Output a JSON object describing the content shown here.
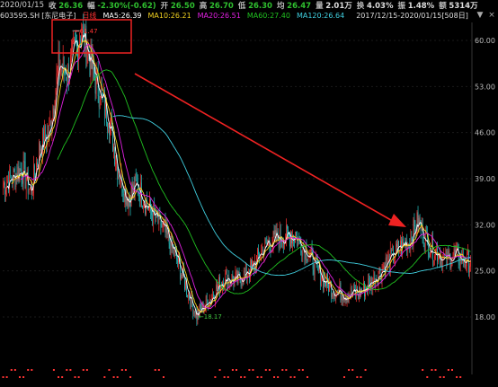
{
  "quote": {
    "date": "2020/01/15",
    "close_label": "收",
    "close": "26.36",
    "change_label": "幅",
    "change": "-2.30%(-0.62)",
    "open_label": "开",
    "open": "26.50",
    "high_label": "高",
    "high": "26.70",
    "low_label": "低",
    "low": "26.30",
    "avg_label": "均",
    "avg": "26.47",
    "volume_label": "量",
    "volume": "2.01万",
    "turnover_label": "换",
    "turnover": "4.03%",
    "amplitude_label": "振",
    "amplitude": "1.48%",
    "amount_label": "额",
    "amount": "5314万"
  },
  "indicators": {
    "symbol": "603595.SH",
    "name": "[东尼电子]",
    "mode": "日线",
    "ma5": "MA5:26.39",
    "ma10": "MA10:26.21",
    "ma20": "MA20:26.51",
    "ma60": "MA60:27.40",
    "ma120": "MA120:26.64",
    "range": "2017/12/15-2020/01/15[508日]"
  },
  "controls": {
    "dropdown": "▼",
    "close": "×"
  },
  "colors": {
    "up": "#ff3333",
    "down": "#28c8c8",
    "ma5": "#ffffff",
    "ma10": "#f0d020",
    "ma20": "#e020e0",
    "ma60": "#20c020",
    "ma120": "#40d0e0",
    "annotation": "#ee2222"
  },
  "annotations": {
    "peak_label": "61.47",
    "trough_label": "18.17"
  },
  "chart_data": {
    "type": "candlestick",
    "y_ticks": [
      "60.00",
      "53.00",
      "46.00",
      "39.00",
      "32.00",
      "25.00",
      "18.00"
    ],
    "ylim": [
      15.5,
      63
    ],
    "x_range": [
      "2017/12/15",
      "2020/01/15"
    ],
    "bars": 508,
    "price_path": [
      [
        0,
        38.0
      ],
      [
        20,
        40.5
      ],
      [
        30,
        37.0
      ],
      [
        40,
        44.0
      ],
      [
        50,
        46.0
      ],
      [
        60,
        56.0
      ],
      [
        70,
        55.0
      ],
      [
        85,
        61.47
      ],
      [
        100,
        54.0
      ],
      [
        115,
        48.0
      ],
      [
        125,
        40.0
      ],
      [
        135,
        36.0
      ],
      [
        145,
        38.0
      ],
      [
        160,
        34.0
      ],
      [
        175,
        31.0
      ],
      [
        190,
        26.0
      ],
      [
        200,
        22.0
      ],
      [
        210,
        18.17
      ],
      [
        225,
        21.0
      ],
      [
        240,
        24.0
      ],
      [
        255,
        23.5
      ],
      [
        270,
        25.5
      ],
      [
        285,
        29.0
      ],
      [
        300,
        30.0
      ],
      [
        315,
        30.5
      ],
      [
        330,
        28.0
      ],
      [
        345,
        24.0
      ],
      [
        360,
        22.0
      ],
      [
        375,
        21.5
      ],
      [
        390,
        22.0
      ],
      [
        400,
        23.5
      ],
      [
        415,
        26.0
      ],
      [
        430,
        28.5
      ],
      [
        440,
        29.5
      ],
      [
        450,
        32.5
      ],
      [
        460,
        29.0
      ],
      [
        470,
        28.0
      ],
      [
        480,
        26.5
      ],
      [
        490,
        27.5
      ],
      [
        500,
        26.5
      ],
      [
        507,
        26.36
      ]
    ]
  }
}
